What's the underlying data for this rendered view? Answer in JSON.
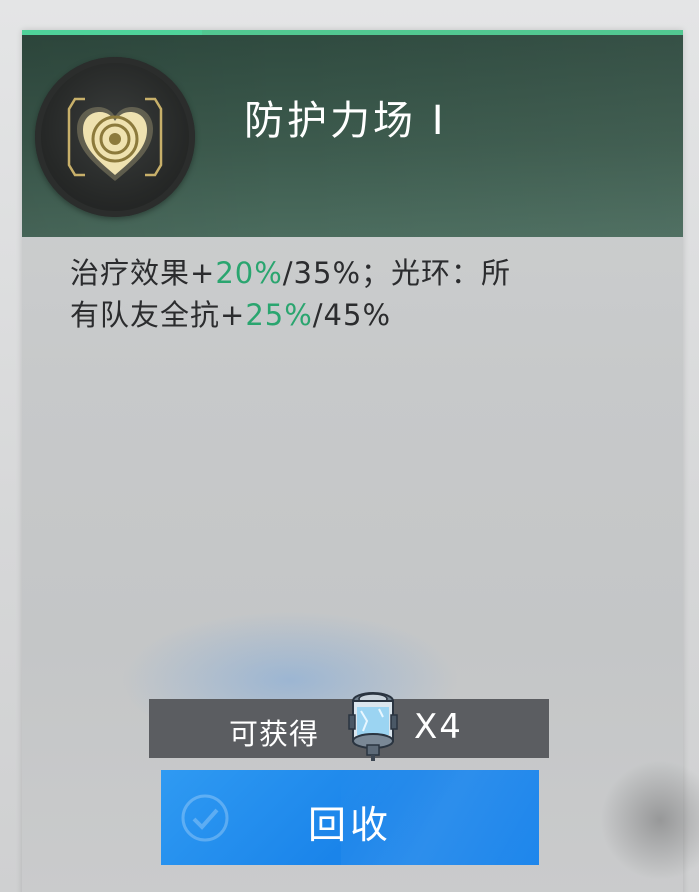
{
  "card": {
    "title": "防护力场 Ⅰ",
    "icon": "heart-shield-icon",
    "accent_color": "#4fd39a",
    "header_color": "#3c5a4d",
    "description": {
      "line1": {
        "prefix": "治疗效果+",
        "highlight": "20%",
        "suffix": "/35%；光环：所"
      },
      "line2": {
        "prefix": "有队友全抗+",
        "highlight": "25%",
        "suffix": "/45%"
      },
      "highlight_color": "#2aa56f"
    }
  },
  "reward": {
    "label": "可获得",
    "item_icon": "energy-canister-icon",
    "quantity": "X4"
  },
  "actions": {
    "recycle_label": "回收",
    "recycle_color": "#1a84ea"
  }
}
